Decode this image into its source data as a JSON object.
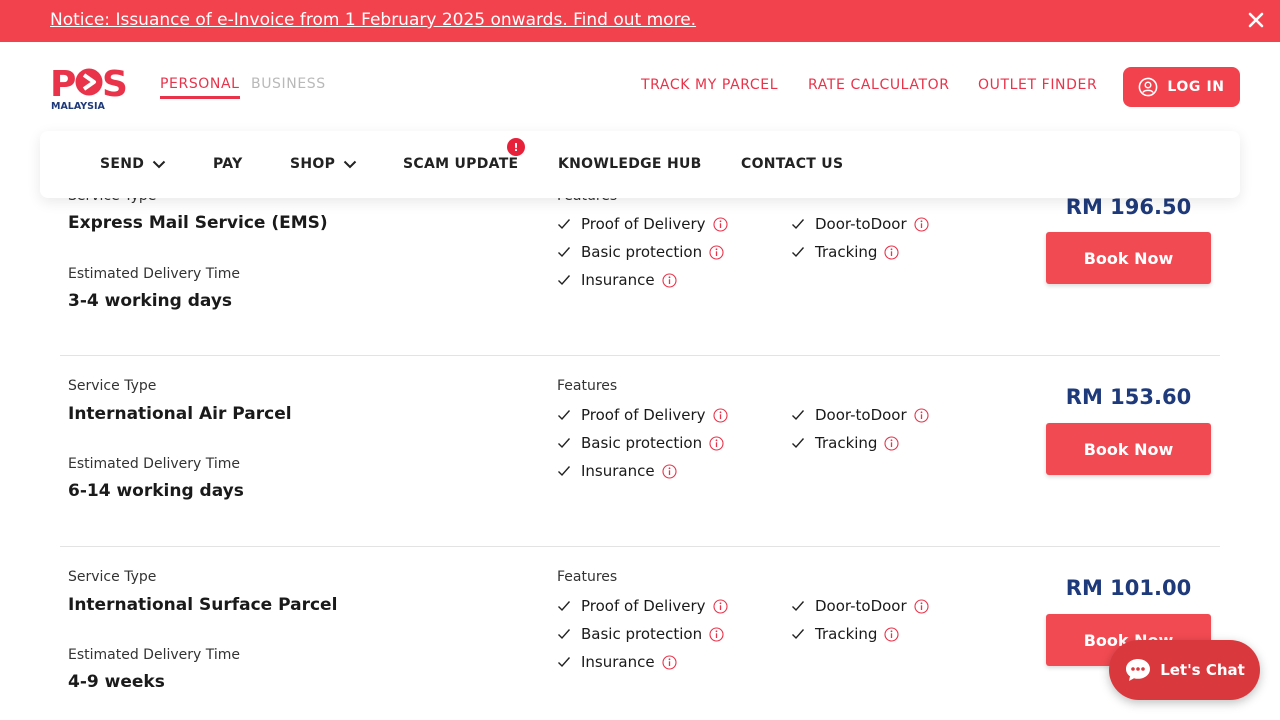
{
  "notice": {
    "text": "Notice: Issuance of e-Invoice from 1 February 2025 onwards. Find out more.",
    "close_icon": "close-icon"
  },
  "brand": {
    "logo_text": "POS",
    "logo_subtext": "MALAYSIA",
    "color": "#e8334a",
    "navy": "#1e3a7a"
  },
  "account_tabs": {
    "personal": "PERSONAL",
    "business": "BUSINESS"
  },
  "top_links": {
    "track": "TRACK MY PARCEL",
    "rate": "RATE CALCULATOR",
    "outlet": "OUTLET FINDER"
  },
  "login": {
    "label": "LOG IN",
    "icon": "user-icon"
  },
  "nav": {
    "send": "SEND",
    "pay": "PAY",
    "shop": "SHOP",
    "scam": "SCAM UPDATE",
    "scam_badge": "!",
    "knowledge": "KNOWLEDGE HUB",
    "contact": "CONTACT US"
  },
  "services": [
    {
      "type_label": "Service Type",
      "name": "Express Mail Service (EMS)",
      "eta_label": "Estimated Delivery Time",
      "eta": "3-4 working days",
      "features_label": "Features",
      "features_left": [
        "Proof of Delivery",
        "Basic protection",
        "Insurance"
      ],
      "features_right": [
        "Door-toDoor",
        "Tracking"
      ],
      "price": "RM 196.50",
      "book": "Book Now"
    },
    {
      "type_label": "Service Type",
      "name": "International Air Parcel",
      "eta_label": "Estimated Delivery Time",
      "eta": "6-14 working days",
      "features_label": "Features",
      "features_left": [
        "Proof of Delivery",
        "Basic protection",
        "Insurance"
      ],
      "features_right": [
        "Door-toDoor",
        "Tracking"
      ],
      "price": "RM 153.60",
      "book": "Book Now"
    },
    {
      "type_label": "Service Type",
      "name": "International Surface Parcel",
      "eta_label": "Estimated Delivery Time",
      "eta": "4-9 weeks",
      "features_label": "Features",
      "features_left": [
        "Proof of Delivery",
        "Basic protection",
        "Insurance"
      ],
      "features_right": [
        "Door-toDoor",
        "Tracking"
      ],
      "price": "RM 101.00",
      "book": "Book Now"
    }
  ],
  "chat": {
    "label": "Let's Chat",
    "icon": "chat-bubble-icon"
  }
}
